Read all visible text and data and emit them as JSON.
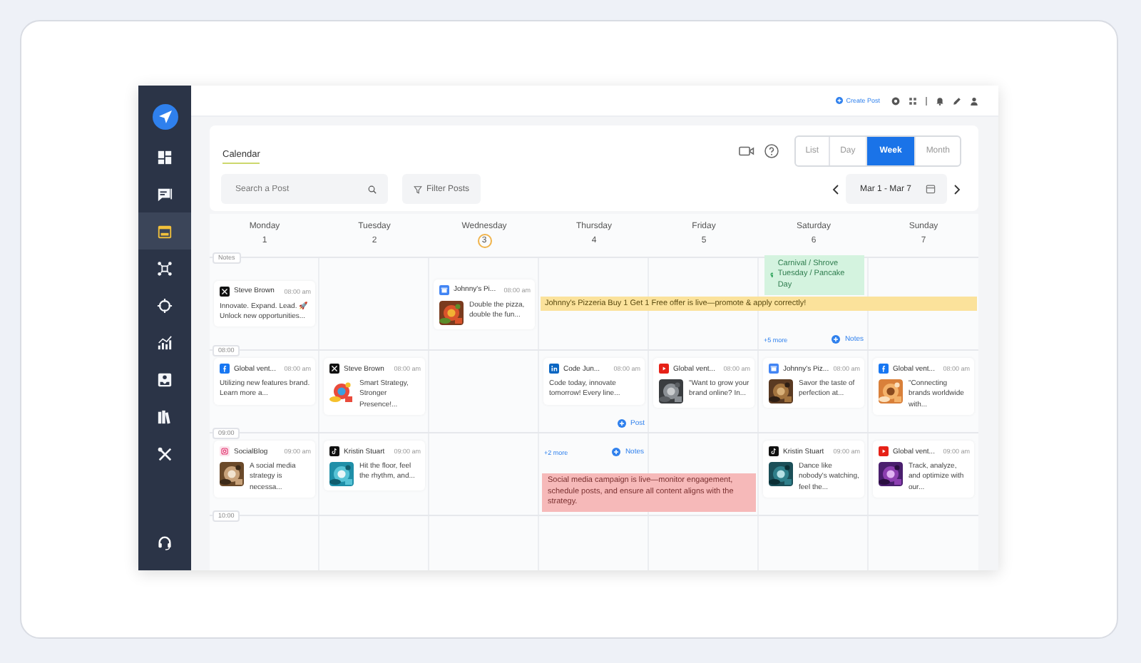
{
  "sidebar": {
    "items": [
      {
        "selected": false
      },
      {
        "selected": false
      },
      {
        "selected": true
      },
      {
        "selected": false
      },
      {
        "selected": false
      },
      {
        "selected": false
      },
      {
        "selected": false
      },
      {
        "selected": false
      },
      {
        "selected": false
      }
    ]
  },
  "top_bar": {
    "create_label": "Create Post"
  },
  "header": {
    "tabs": [
      {
        "label": "Calendar",
        "selected": true
      }
    ],
    "views": [
      {
        "label": "List",
        "selected": false
      },
      {
        "label": "Day",
        "selected": false
      },
      {
        "label": "Week",
        "selected": true
      },
      {
        "label": "Month",
        "selected": false
      }
    ],
    "search": {
      "placeholder": "Search a Post"
    },
    "filter_label": "Filter Posts",
    "date_range": "Mar 1 - Mar 7"
  },
  "days": [
    {
      "name": "Monday",
      "date": "1",
      "today": false
    },
    {
      "name": "Tuesday",
      "date": "2",
      "today": false
    },
    {
      "name": "Wednesday",
      "date": "3",
      "today": true
    },
    {
      "name": "Thursday",
      "date": "4",
      "today": false
    },
    {
      "name": "Friday",
      "date": "5",
      "today": false
    },
    {
      "name": "Saturday",
      "date": "6",
      "today": false
    },
    {
      "name": "Sunday",
      "date": "7",
      "today": false
    }
  ],
  "blocks": [
    {
      "label": "Notes",
      "kind": "notes",
      "cells": [
        [
          {
            "kind": "post",
            "channel": {
              "kind": "x"
            },
            "author": "Steve Brown",
            "time": "08:00 am",
            "text": "Innovate. Expand. Lead. 🚀 Unlock new opportunities...",
            "picture": false
          }
        ],
        [],
        [
          {
            "kind": "post",
            "channel": {
              "kind": "google"
            },
            "author": "Johnny's Pi...",
            "time": "08:00 am",
            "text": "Double the pizza, double the fun...",
            "picture": true
          }
        ],
        [
          {
            "kind": "banner",
            "text": "Johnny's Pizzeria Buy 1 Get 1 Free offer is live—promote & apply correctly!"
          }
        ],
        [],
        [
          {
            "kind": "holiday",
            "text": "Carnival / Shrove Tuesday / Pancake Day"
          },
          {
            "kind": "more",
            "more": "+5 more",
            "button": "Notes"
          }
        ],
        []
      ]
    },
    {
      "label": "08:00",
      "kind": "hour",
      "cells": [
        [
          {
            "kind": "post",
            "channel": {
              "kind": "facebook"
            },
            "author": "Global vent...",
            "time": "08:00 am",
            "text": "Utilizing new features brand. Learn more a...",
            "picture": false
          }
        ],
        [
          {
            "kind": "post",
            "channel": {
              "kind": "x"
            },
            "author": "Steve Brown",
            "time": "08:00 am",
            "text": "Smart Strategy, Stronger Presence!...",
            "picture": true
          }
        ],
        [],
        [
          {
            "kind": "post",
            "channel": {
              "kind": "linkedin"
            },
            "author": "Code Jun...",
            "time": "08:00 am",
            "text": "Code today, innovate tomorrow! Every line...",
            "picture": false
          },
          {
            "kind": "add-post",
            "button": "Post"
          }
        ],
        [
          {
            "kind": "post",
            "channel": {
              "kind": "youtube"
            },
            "author": "Global vent...",
            "time": "08:00 am",
            "text": "\"Want to grow your brand online? In...",
            "picture": true
          }
        ],
        [
          {
            "kind": "post",
            "channel": {
              "kind": "google"
            },
            "author": "Johnny's Piz...",
            "time": "08:00 am",
            "text": "Savor the taste of perfection at...",
            "picture": true
          }
        ],
        [
          {
            "kind": "post",
            "channel": {
              "kind": "facebook"
            },
            "author": "Global vent...",
            "time": "08:00 am",
            "text": "\"Connecting brands worldwide with...",
            "picture": true
          }
        ]
      ]
    },
    {
      "label": "09:00",
      "kind": "hour",
      "cells": [
        [
          {
            "kind": "post",
            "channel": {
              "kind": "instagram"
            },
            "author": "SocialBlog",
            "time": "09:00 am",
            "text": "A social media strategy is necessa...",
            "picture": true
          }
        ],
        [
          {
            "kind": "post",
            "channel": {
              "kind": "tiktok"
            },
            "author": "Kristin Stuart",
            "time": "09:00 am",
            "text": "Hit the floor, feel the rhythm, and...",
            "picture": true
          }
        ],
        [],
        [
          {
            "kind": "more",
            "more": "+2 more",
            "button": "Notes"
          },
          {
            "kind": "note",
            "text": "Social media campaign is live—monitor engagement, schedule posts, and ensure all content aligns with the strategy."
          }
        ],
        [],
        [
          {
            "kind": "post",
            "channel": {
              "kind": "tiktok"
            },
            "author": "Kristin Stuart",
            "time": "09:00 am",
            "text": "Dance like nobody's watching, feel the...",
            "picture": true
          }
        ],
        [
          {
            "kind": "post",
            "channel": {
              "kind": "youtube"
            },
            "author": "Global vent...",
            "time": "09:00 am",
            "text": "Track, analyze, and optimize with our...",
            "picture": true
          }
        ]
      ]
    },
    {
      "label": "10:00",
      "kind": "hour",
      "cells": [
        [],
        [],
        [],
        [],
        [],
        [],
        []
      ]
    }
  ]
}
